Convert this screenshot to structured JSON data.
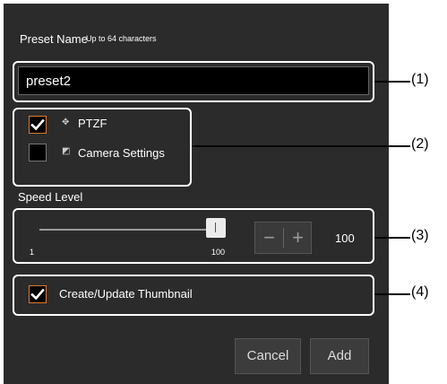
{
  "preset_name": {
    "label": "Preset Name",
    "hint": "Up to 64 characters",
    "value": "preset2"
  },
  "options": {
    "ptzf": {
      "label": "PTZF",
      "checked": true,
      "icon": "ptzf-icon"
    },
    "camera_settings": {
      "label": "Camera Settings",
      "checked": false,
      "icon": "camera-settings-icon"
    }
  },
  "speed": {
    "label": "Speed Level",
    "min_label": "1",
    "max_label": "100",
    "value": "100",
    "decrement_label": "−",
    "increment_label": "+"
  },
  "thumbnail": {
    "label": "Create/Update Thumbnail",
    "checked": true
  },
  "buttons": {
    "cancel": "Cancel",
    "add": "Add"
  },
  "callouts": {
    "c1": "(1)",
    "c2": "(2)",
    "c3": "(3)",
    "c4": "(4)"
  },
  "colors": {
    "panel_bg": "#2b2b2b",
    "check_accent": "#e07a28"
  }
}
